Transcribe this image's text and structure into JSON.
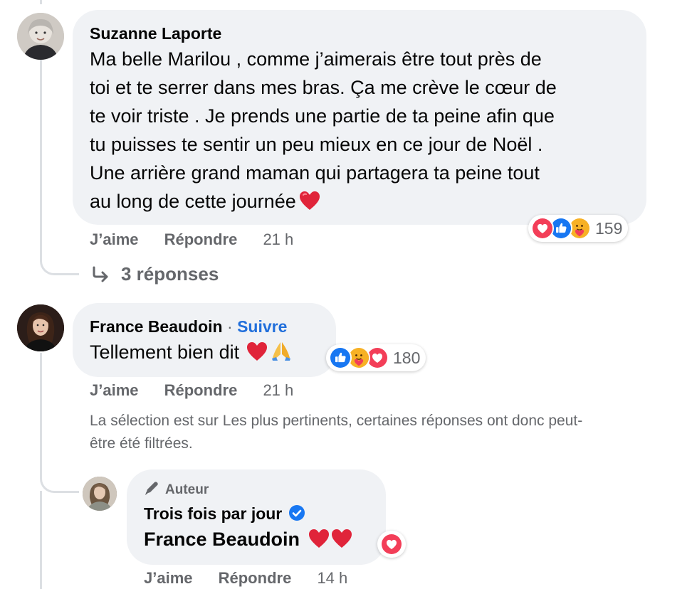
{
  "comments": [
    {
      "author": "Suzanne Laporte",
      "text_lines": [
        "Ma belle Marilou , comme j’aimerais être tout près de",
        "toi et te serrer dans mes bras. Ça me crève le cœur de",
        "te voir triste . Je prends une partie de ta peine afin que",
        "tu puisses te sentir un peu mieux en ce jour de Noël .",
        "Une arrière grand maman qui partagera ta peine tout",
        "au long de cette journée"
      ],
      "reactions": [
        "love-icon",
        "like-icon",
        "care-icon"
      ],
      "reaction_count": "159",
      "like_label": "J’aime",
      "reply_label": "Répondre",
      "time": "21 h",
      "replies_label": "3 réponses"
    },
    {
      "author": "France Beaudoin",
      "separator": "·",
      "follow_label": "Suivre",
      "text": "Tellement bien dit",
      "reactions": [
        "like-icon",
        "care-icon",
        "love-icon"
      ],
      "reaction_count": "180",
      "like_label": "J’aime",
      "reply_label": "Répondre",
      "time": "21 h"
    }
  ],
  "filter_notice": {
    "line1": "La sélection est sur Les plus pertinents, certaines réponses ont donc peut-",
    "line2": "être été filtrées."
  },
  "reply": {
    "badge_label": "Auteur",
    "author": "Trois fois par jour",
    "text": "France Beaudoin",
    "reactions": [
      "love-icon"
    ],
    "like_label": "J’aime",
    "reply_label": "Répondre",
    "time": "14 h"
  },
  "colors": {
    "bubble": "#f0f2f5",
    "secondary_text": "#65676b",
    "link_blue": "#216fdb",
    "love_red": "#f33e58",
    "like_blue": "#1877f2",
    "heart_emoji": "#e0243a"
  }
}
